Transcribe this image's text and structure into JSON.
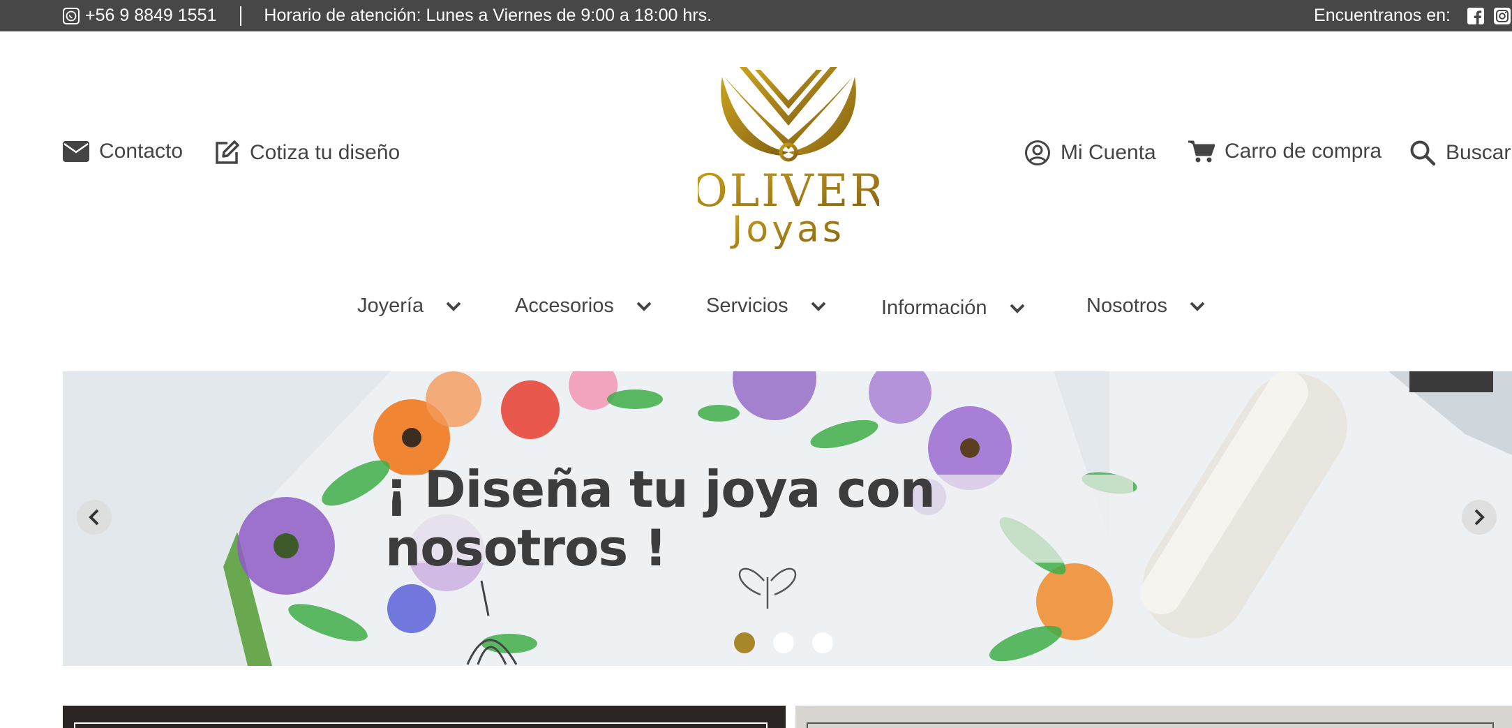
{
  "topbar": {
    "phone": "+56 9 8849 1551",
    "hours": "Horario de atención: Lunes a Viernes de 9:00 a 18:00 hrs.",
    "find_us": "Encuentranos en:",
    "icons": [
      "whatsapp-icon",
      "facebook-icon",
      "instagram-icon"
    ]
  },
  "header": {
    "contact": "Contacto",
    "quote": "Cotiza tu diseño",
    "account": "Mi Cuenta",
    "cart": "Carro de compra",
    "search": "Buscar",
    "logo_line1": "OLIVER",
    "logo_line2": "Joyas"
  },
  "menu": [
    {
      "label": "Joyería"
    },
    {
      "label": "Accesorios"
    },
    {
      "label": "Servicios"
    },
    {
      "label": "Información"
    },
    {
      "label": "Nosotros"
    }
  ],
  "hero": {
    "caption": "¡ Diseña tu joya con nosotros !",
    "slides_total": 3,
    "active_slide": 1
  },
  "colors": {
    "topbar_bg": "#474747",
    "gold": "#a8872a",
    "text": "#444444"
  }
}
